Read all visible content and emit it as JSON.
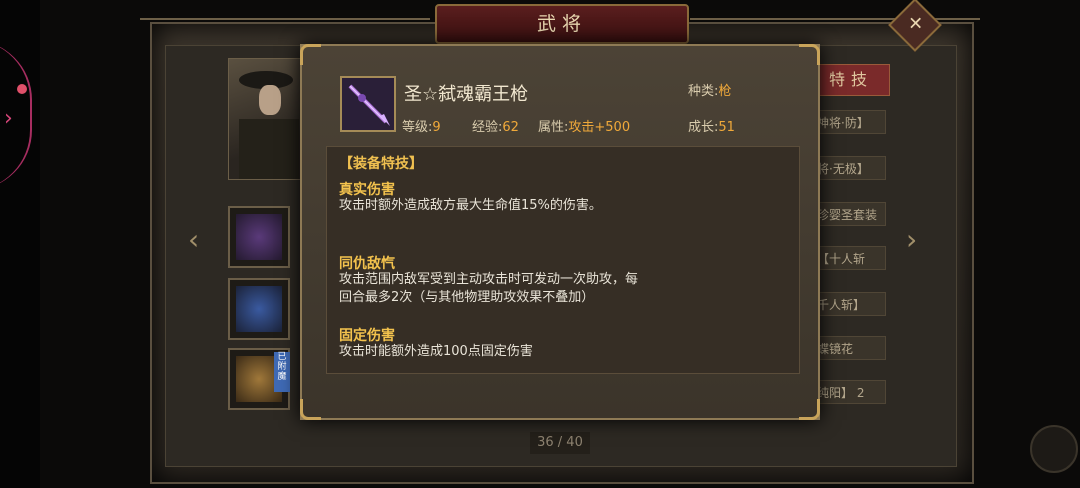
{
  "screen_title": "武将",
  "close_symbol": "✕",
  "skill_tab_label": "特技",
  "right_labels": [
    "神将·防】",
    "将·无极】",
    "珍婴圣套装",
    "【十人斩",
    "千人斩】",
    "蝶镜花",
    "纯阳】 2"
  ],
  "slot_badge": "已附魔",
  "page_indicator": "36 / 40",
  "popup": {
    "item_name": "圣☆弑魂霸王枪",
    "type_label": "种类:",
    "type_value": "枪",
    "level_label": "等级:",
    "level_value": "9",
    "exp_label": "经验:",
    "exp_value": "62",
    "attr_label": "属性:",
    "attr_value": "攻击+500",
    "growth_label": "成长:",
    "growth_value": "51",
    "section_title": "【装备特技】",
    "skills": [
      {
        "name": "真实伤害",
        "desc": "攻击时额外造成敌方最大生命值15%的伤害。"
      },
      {
        "name": "同仇敌忾",
        "desc": "攻击范围内敌军受到主动攻击时可发动一次助攻，每\n回合最多2次（与其他物理助攻效果不叠加）"
      },
      {
        "name": "固定伤害",
        "desc": "攻击时能额外造成100点固定伤害"
      }
    ]
  },
  "colors": {
    "accent_gold": "#f3c24d",
    "value_orange": "#f0a93a",
    "banner_red": "#5a1e1e"
  }
}
